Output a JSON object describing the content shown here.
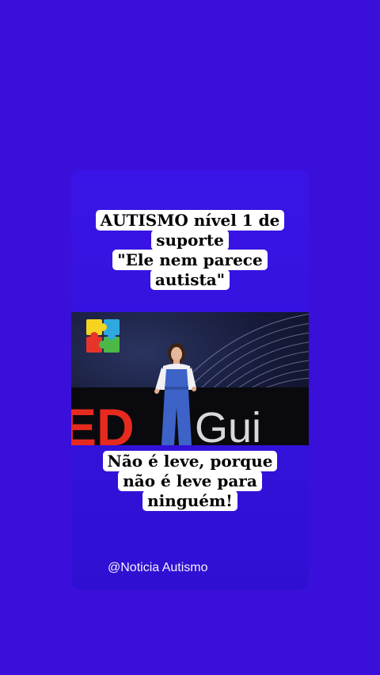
{
  "top_caption": {
    "lines": [
      "AUTISMO nível 1 de",
      "suporte",
      "\"Ele nem parece",
      "autista\""
    ]
  },
  "bottom_caption": {
    "lines": [
      "Não é leve, porque",
      "não é leve para",
      "ninguém!"
    ]
  },
  "video": {
    "stage_logo_text": "Gui",
    "icon": "puzzle-pieces-icon"
  },
  "watermark": "@Noticia Autismo",
  "colors": {
    "background": "#3a0fd9",
    "caption_bg": "#ffffff",
    "ted_red": "#e62b1e"
  }
}
